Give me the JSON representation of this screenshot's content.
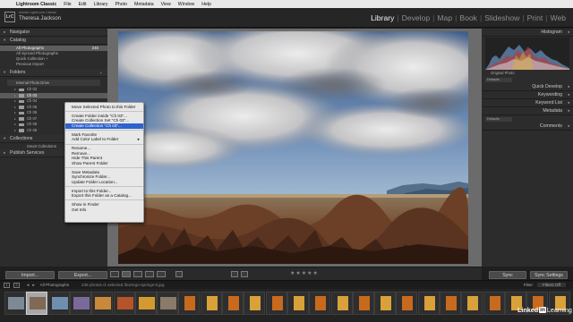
{
  "menubar": {
    "app": "Lightroom Classic",
    "items": [
      "File",
      "Edit",
      "Library",
      "Photo",
      "Metadata",
      "View",
      "Window",
      "Help"
    ]
  },
  "identity": {
    "product": "Adobe Lightroom Classic",
    "user": "Theresa Jackson",
    "logo": "LrC"
  },
  "modules": [
    "Library",
    "Develop",
    "Map",
    "Book",
    "Slideshow",
    "Print",
    "Web"
  ],
  "active_module": "Library",
  "left_panel": {
    "navigator": "Navigator",
    "catalog": "Catalog",
    "catalog_items": [
      {
        "label": "All Photographs",
        "count": "245"
      },
      {
        "label": "All Synced Photographs",
        "count": ""
      },
      {
        "label": "Quick Collection +",
        "count": ""
      },
      {
        "label": "Previous Import",
        "count": ""
      }
    ],
    "folders": "Folders",
    "drive": "Internal Photo Drive",
    "folder_items": [
      "Ch 02",
      "Ch 03",
      "Ch 04",
      "Ch 05",
      "Ch 06",
      "Ch 07",
      "Ch 08",
      "Ch 09"
    ],
    "highlighted_folder_index": 1,
    "collections": "Collections",
    "smart_collections": "Smart Collections",
    "publish_services": "Publish Services",
    "import_label": "Import...",
    "export_label": "Export..."
  },
  "right_panel": {
    "histogram": "Histogram",
    "original_photo": "Original Photo",
    "quick_develop": "Quick Develop",
    "keywording": "Keywording",
    "keyword_list": "Keyword List",
    "metadata": "Metadata",
    "comments": "Comments",
    "default_select": "Defaults",
    "sync_label": "Sync",
    "sync_settings_label": "Sync Settings"
  },
  "context_menu": {
    "items": [
      "Move Selected Photo to this Folder",
      "---",
      "Create Folder inside \"Ch 03\"...",
      "Create Collection Set \"Ch 03\"...",
      "Create Collection \"Ch 03\"...",
      "---",
      "Mark Favorite",
      "Add Color Label to Folder",
      "---",
      "Rename...",
      "Remove...",
      "Hide This Parent",
      "Show Parent Folder",
      "---",
      "Save Metadata",
      "Synchronize Folder...",
      "Update Folder Location...",
      "---",
      "Import to this Folder...",
      "Export this Folder as a Catalog...",
      "---",
      "Show in Finder",
      "Get Info"
    ],
    "highlighted_index": 4,
    "submenu_index": 7
  },
  "filmstrip": {
    "page_buttons": [
      "1",
      "2"
    ],
    "source": "All Photographs",
    "status": "245 photos /1 selected /borrego-springs-5.jpg",
    "filter_label": "Filter:",
    "filter_value": "Filters Off",
    "thumb_count": 26,
    "selected_thumb": 1
  },
  "watermark": {
    "brand": "Linked",
    "in": "in",
    "suffix": "Learning"
  },
  "colors": {
    "menu_highlight": "#2e63cf",
    "panel_bg": "#2c2c2c",
    "workspace_bg": "#6b6b6b"
  }
}
